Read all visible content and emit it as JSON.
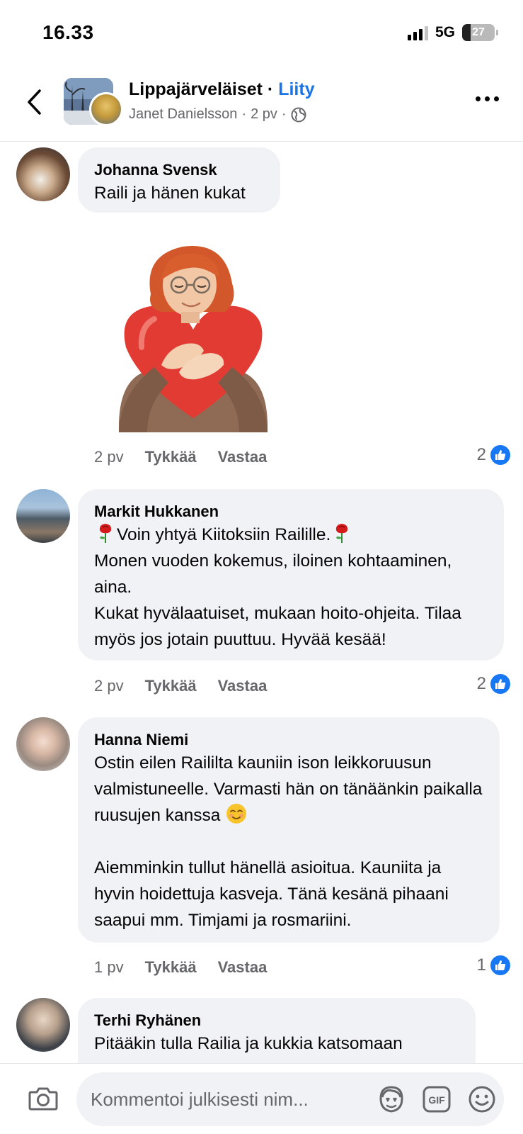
{
  "status_bar": {
    "time": "16.33",
    "network": "5G",
    "battery": "27"
  },
  "header": {
    "group_name": "Lippajärveläiset",
    "separator": " · ",
    "join_label": "Liity",
    "poster_name": "Janet Danielsson",
    "post_age": "2 pv",
    "sub_sep": "·",
    "accent_color": "#1b74e4"
  },
  "comments": [
    {
      "author": "Johanna Svensk",
      "text": "Raili ja hänen kukat",
      "has_sticker": true,
      "age": "2 pv",
      "like_label": "Tykkää",
      "reply_label": "Vastaa",
      "reaction_count": "2"
    },
    {
      "author": "Markit Hukkanen",
      "line1": "Voin yhtyä Kiitoksiin Railille.",
      "text": "Monen vuoden kokemus, iloinen kohtaaminen, aina.\nKukat hyvälaatuiset, mukaan hoito-ohjeita. Tilaa myös jos jotain puuttuu. Hyvää kesää!",
      "age": "2 pv",
      "like_label": "Tykkää",
      "reply_label": "Vastaa",
      "reaction_count": "2"
    },
    {
      "author": "Hanna Niemi",
      "text1": "Ostin eilen Raililta kauniin ison leikkoruusun valmistuneelle. Varmasti hän on tänäänkin paikalla ruusujen kanssa",
      "text2": "Aiemminkin tullut hänellä asioitua. Kauniita ja hyvin hoidettuja kasveja. Tänä kesänä pihaani saapui mm. Timjami ja rosmariini.",
      "age": "1 pv",
      "like_label": "Tykkää",
      "reply_label": "Vastaa",
      "reaction_count": "1"
    },
    {
      "author": "Terhi Ryhänen",
      "text": "Pitääkin tulla Railia ja kukkia katsomaan"
    }
  ],
  "composer": {
    "placeholder": "Kommentoi julkisesti nim..."
  },
  "icons": {
    "back": "chevron-left-icon",
    "more": "more-dots-icon",
    "globe": "globe-icon",
    "like": "like-thumb-icon",
    "camera": "camera-icon",
    "avatar_sticker": "avatar-sticker-icon",
    "gif": "gif-icon",
    "emoji": "emoji-icon"
  }
}
